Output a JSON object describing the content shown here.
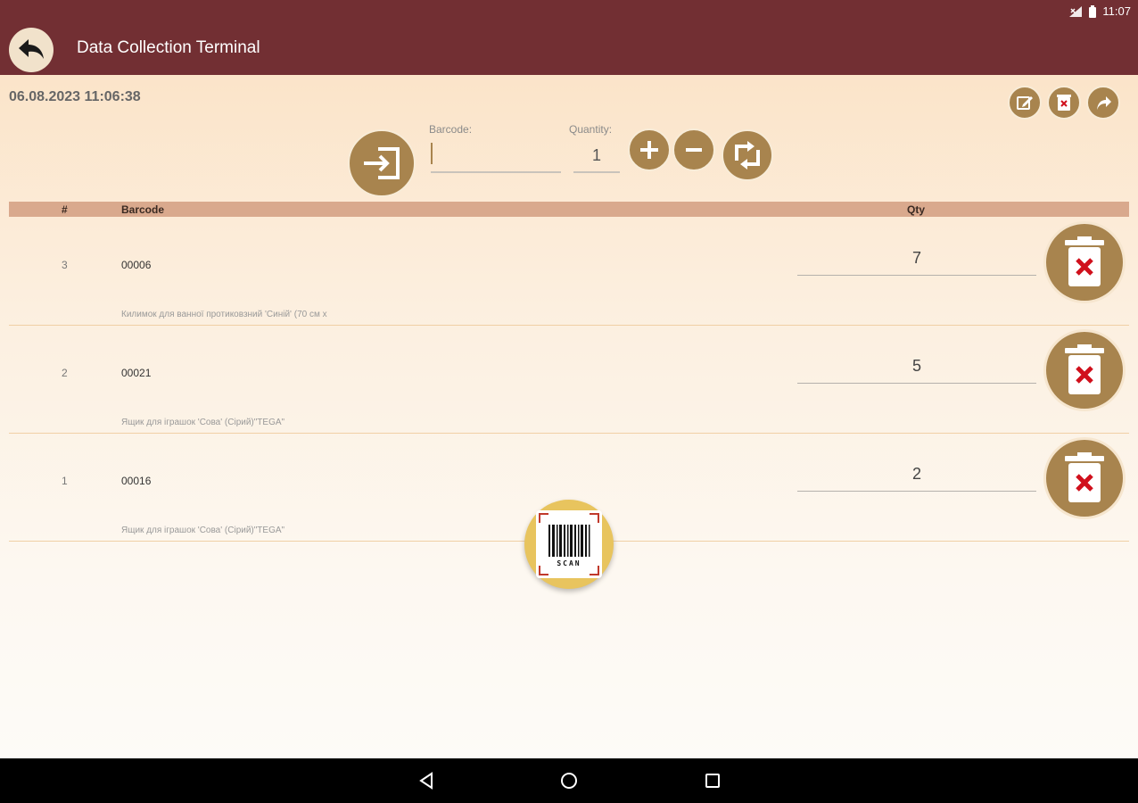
{
  "status": {
    "time": "11:07"
  },
  "appbar": {
    "title": "Data Collection Terminal"
  },
  "document": {
    "timestamp": "06.08.2023 11:06:38"
  },
  "entry": {
    "barcode_label": "Barcode:",
    "barcode_value": "",
    "quantity_label": "Quantity:",
    "quantity_value": "1"
  },
  "table": {
    "headers": {
      "num": "#",
      "barcode": "Barcode",
      "qty": "Qty"
    },
    "rows": [
      {
        "num": "3",
        "barcode": "00006",
        "qty": "7",
        "description": "Килимок для ванної  протиковзний 'Синій' (70 см х"
      },
      {
        "num": "2",
        "barcode": "00021",
        "qty": "5",
        "description": "Ящик для іграшок 'Сова' (Сірий)\"TEGA\""
      },
      {
        "num": "1",
        "barcode": "00016",
        "qty": "2",
        "description": "Ящик для іграшок 'Сова' (Сірий)\"TEGA\""
      }
    ]
  },
  "scan": {
    "label": "SCAN"
  },
  "colors": {
    "primary": "#722f33",
    "accent": "#a8844e",
    "header_row": "#d9a98d",
    "delete_x": "#d0101c",
    "scan_fab": "#e8c45e"
  },
  "icons": [
    "back-arrow-icon",
    "edit-icon",
    "delete-document-icon",
    "share-icon",
    "enter-icon",
    "plus-icon",
    "minus-icon",
    "swap-icon",
    "trash-icon",
    "barcode-scan-icon",
    "nav-back-icon",
    "nav-home-icon",
    "nav-recents-icon"
  ]
}
